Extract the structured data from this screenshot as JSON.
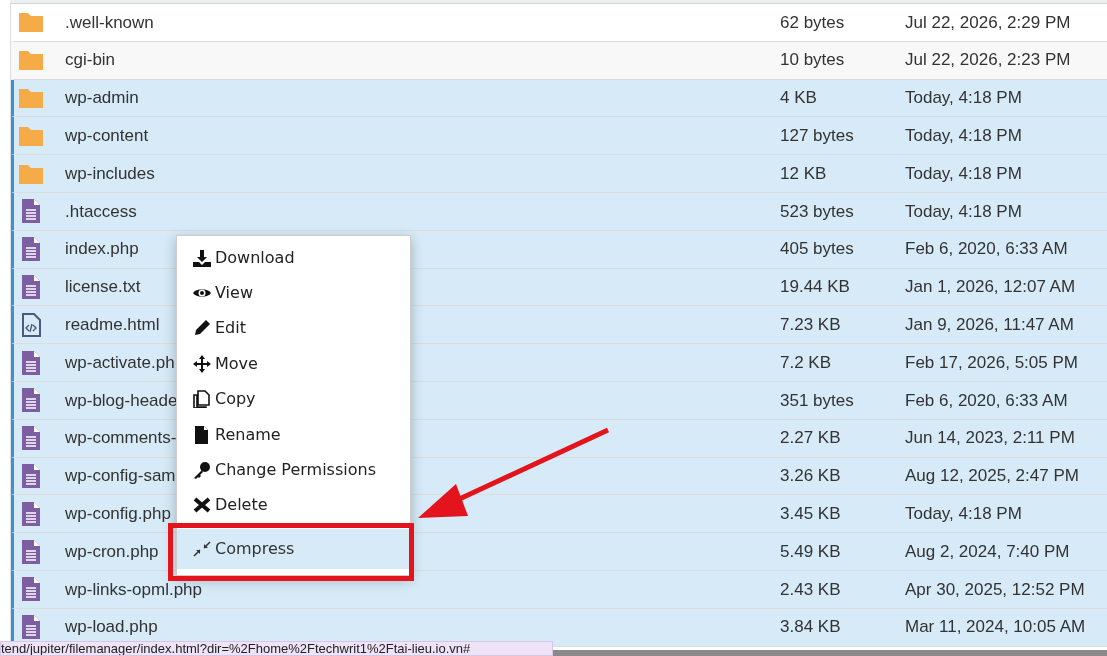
{
  "files": [
    {
      "kind": "folder",
      "name": ".well-known",
      "size": "62 bytes",
      "modified": "Jul 22, 2026, 2:29 PM",
      "selected": false
    },
    {
      "kind": "folder",
      "name": "cgi-bin",
      "size": "10 bytes",
      "modified": "Jul 22, 2026, 2:23 PM",
      "selected": false
    },
    {
      "kind": "folder",
      "name": "wp-admin",
      "size": "4 KB",
      "modified": "Today, 4:18 PM",
      "selected": true
    },
    {
      "kind": "folder",
      "name": "wp-content",
      "size": "127 bytes",
      "modified": "Today, 4:18 PM",
      "selected": true
    },
    {
      "kind": "folder",
      "name": "wp-includes",
      "size": "12 KB",
      "modified": "Today, 4:18 PM",
      "selected": true
    },
    {
      "kind": "text",
      "name": ".htaccess",
      "size": "523 bytes",
      "modified": "Today, 4:18 PM",
      "selected": true
    },
    {
      "kind": "text",
      "name": "index.php",
      "size": "405 bytes",
      "modified": "Feb 6, 2020, 6:33 AM",
      "selected": true
    },
    {
      "kind": "text",
      "name": "license.txt",
      "size": "19.44 KB",
      "modified": "Jan 1, 2026, 12:07 AM",
      "selected": true
    },
    {
      "kind": "code",
      "name": "readme.html",
      "size": "7.23 KB",
      "modified": "Jan 9, 2026, 11:47 AM",
      "selected": true
    },
    {
      "kind": "text",
      "name": "wp-activate.ph",
      "size": "7.2 KB",
      "modified": "Feb 17, 2026, 5:05 PM",
      "selected": true
    },
    {
      "kind": "text",
      "name": "wp-blog-heade",
      "size": "351 bytes",
      "modified": "Feb 6, 2020, 6:33 AM",
      "selected": true
    },
    {
      "kind": "text",
      "name": "wp-comments-",
      "size": "2.27 KB",
      "modified": "Jun 14, 2023, 2:11 PM",
      "selected": true
    },
    {
      "kind": "text",
      "name": "wp-config-sam",
      "size": "3.26 KB",
      "modified": "Aug 12, 2025, 2:47 PM",
      "selected": true
    },
    {
      "kind": "text",
      "name": "wp-config.php",
      "size": "3.45 KB",
      "modified": "Today, 4:18 PM",
      "selected": true
    },
    {
      "kind": "text",
      "name": "wp-cron.php",
      "size": "5.49 KB",
      "modified": "Aug 2, 2024, 7:40 PM",
      "selected": true
    },
    {
      "kind": "text",
      "name": "wp-links-opml.php",
      "size": "2.43 KB",
      "modified": "Apr 30, 2025, 12:52 PM",
      "selected": true
    },
    {
      "kind": "text",
      "name": "wp-load.php",
      "size": "3.84 KB",
      "modified": "Mar 11, 2024, 10:05 AM",
      "selected": true
    }
  ],
  "context_menu": [
    {
      "kind": "download",
      "label": "Download",
      "selected": false
    },
    {
      "kind": "view",
      "label": "View",
      "selected": false
    },
    {
      "kind": "edit",
      "label": "Edit",
      "selected": false
    },
    {
      "kind": "move",
      "label": "Move",
      "selected": false
    },
    {
      "kind": "copy",
      "label": "Copy",
      "selected": false
    },
    {
      "kind": "rename",
      "label": "Rename",
      "selected": false
    },
    {
      "kind": "permissions",
      "label": "Change Permissions",
      "selected": false
    },
    {
      "kind": "delete",
      "label": "Delete",
      "selected": false
    },
    {
      "kind": "compress",
      "label": "Compress",
      "selected": true
    }
  ],
  "status_bar": {
    "link": "tend/jupiter/filemanager/index.html?dir=%2Fhome%2Ftechwrit1%2Ftai-lieu.io.vn#"
  }
}
